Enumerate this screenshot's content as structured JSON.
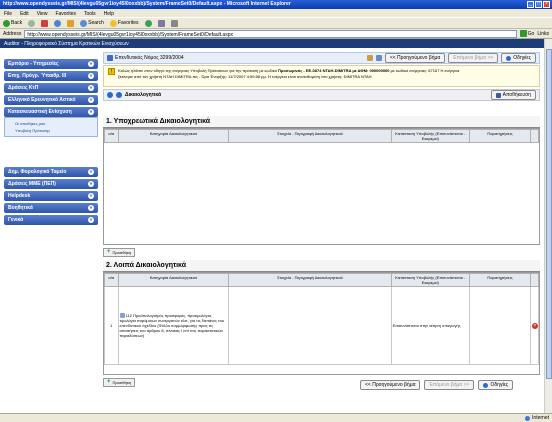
{
  "window": {
    "title": "http://www.opendysseis.gr/MIS/(4levgu05gvr1ioy45l0oxxbb)/System/FrameSet0/Default.aspx - Microsoft Internet Explorer"
  },
  "menu": [
    "File",
    "Edit",
    "View",
    "Favorites",
    "Tools",
    "Help"
  ],
  "toolbar": {
    "back": "Back",
    "search": "Search",
    "favorites": "Favorites"
  },
  "address": {
    "label": "Address",
    "url": "http://www.opendysseis.gr/MIS/(4levgu05gvr1ioy45l0oxxbb)/System/FrameSet0/Default.aspx",
    "go": "Go",
    "links": "Links"
  },
  "app": {
    "header": "Auditor - Πληροφοριακό Σύστημα Κρατικών Ενισχύσεων",
    "breadcrumb": "Επενδυτικός Νόμος 3299/2004",
    "prev_step": "<< Προηγούμενο βήμα",
    "next_step": "Επόμενο βήμα >>",
    "guide": "Οδηγίες",
    "info_line1": "Καλώς ήλθατε στον οδηγό της ενέργειας Υποβολή Πρότασεων για την πρόταση με κωδικό",
    "proposal_code": "Προσωρινός - ΕΕ-0874",
    "proposal_mid": "ΝΤΑΗ-DIMITRA με ΑΦΜ: 000000000",
    "info_line1_end": "με κωδικό ενέργειας: 67167 Η ενέργεια",
    "info_line2": "ξεκίνησε από τον χρήστη ΝΤΑΗ DIMITRA πις - Ώρα Έναρξης: 11/7/2007 4:59:58 μμ. Η ενέργεια είναι ανατεθειμένη στο χρήστη: DIMITRA NTAH",
    "section_label": "Δικαιολογητικά",
    "save": "Αποθήκευση"
  },
  "sidebar": {
    "items": [
      {
        "label": "Εμπόριο - Υπηρεσίες"
      },
      {
        "label": "Επιχ. Πρόγρ. Ύπαιθρ. ΙΙΙ"
      },
      {
        "label": "Δράσεις ΚτΠ"
      },
      {
        "label": "Ελληνικό Ερευνητικό Αστικό"
      },
      {
        "label": "Κατασκευαστική Ενίσχυση"
      },
      {
        "label": "Δημ. Φορολογικό Ταμείο"
      },
      {
        "label": "Δράσεις ΜΜΕ (ΠΕΠ)"
      },
      {
        "label": "Helpdesk"
      },
      {
        "label": "Βοηθητικά"
      },
      {
        "label": "Γενικά"
      }
    ],
    "subitems": [
      "Οι αποθήκες μου",
      "Υποβολή Πρότασης"
    ]
  },
  "section1": {
    "title": "1. Υποχρεωτικά Δικαιολογητικά",
    "columns": [
      "α/α",
      "Κατηγορία Δικαιολογητικού",
      "Στοιχεία - Περιγραφή Δικαιολογητικού",
      "Κατάσταση Υποβολής (Επισυνάπτεται - Εκκρεμεί)",
      "Παρατηρήσεις"
    ],
    "add": "Προσθήκη"
  },
  "section2": {
    "title": "2. Λοιπά Δικαιολογητικά",
    "columns": [
      "α/α",
      "Κατηγορία Δικαιολογητικού",
      "Στοιχεία - Περιγραφή Δικαιολογητικού",
      "Κατάσταση Υποβολής (Επισυνάπτεται - Εκκρεμεί)",
      "Παρατηρήσεις"
    ],
    "rows": [
      {
        "num": "1",
        "category": "112 Προϋπολογισμός προσφορές, προτιμολόγια, τιμολόγια παρόμοιων συνεργατών κλπ, για τις δαπάνες του επενδυτικού σχεδίου (Φύλλο συμμόρφωσης προς τις απαιτήσεις του άρθρου 8, πίνακας Ι επί τοις παραστατικών παραδόσεων)",
        "description": "",
        "status": "Επισυνάπτεται στην αίτηση υπαγωγής",
        "notes": ""
      }
    ],
    "add": "Προσθήκη"
  },
  "status": {
    "left": "",
    "right": "Internet"
  }
}
